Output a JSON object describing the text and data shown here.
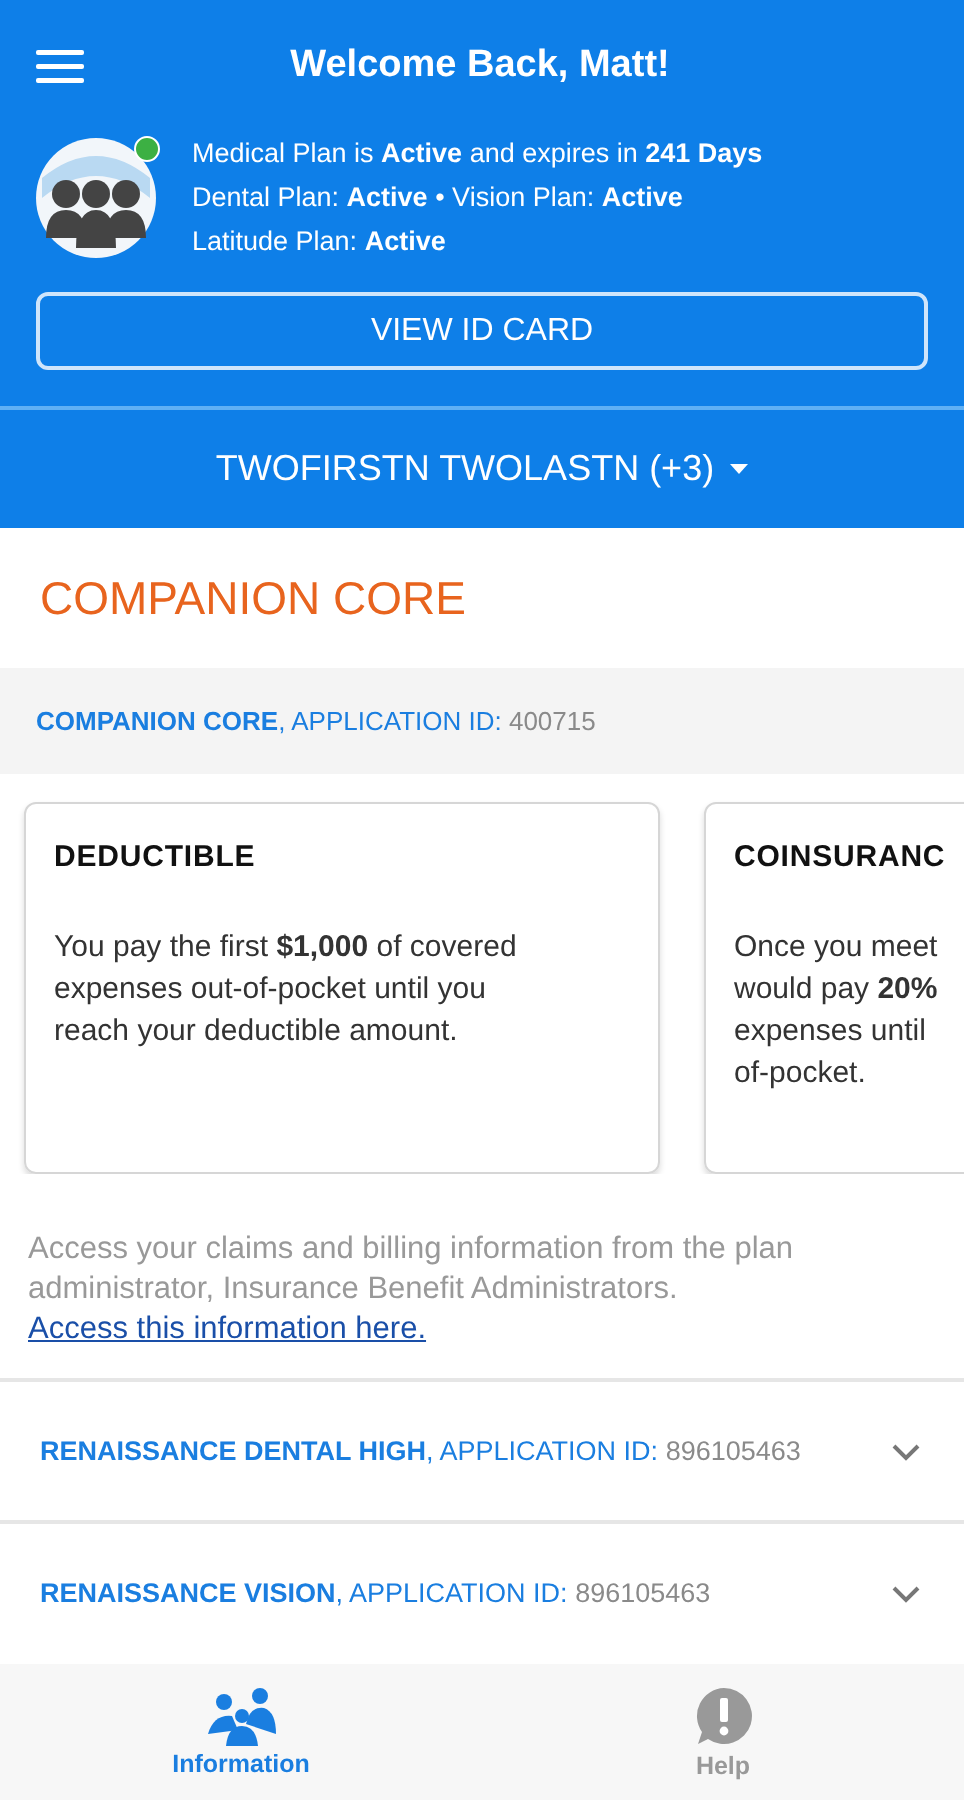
{
  "header": {
    "title": "Welcome Back, Matt!",
    "status_online": true,
    "status_lines": [
      "Medical Plan is **Active** and expires in **241 Days**",
      "Dental Plan: **Active** • Vision Plan:  **Active**",
      "Latitude Plan: **Active**"
    ],
    "id_card_button": "VIEW ID CARD"
  },
  "member_selector": {
    "label": "TWOFIRSTN TWOLASTN (+3)"
  },
  "plan": {
    "title": "COMPANION CORE",
    "name": "COMPANION CORE",
    "id_label": ", APPLICATION ID:",
    "id": "400715"
  },
  "cards": [
    {
      "title": "DEDUCTIBLE",
      "lines": [
        "You pay the first **$1,000** of covered",
        "expenses out-of-pocket until you",
        "reach your deductible amount."
      ]
    },
    {
      "title": "COINSURANC",
      "lines": [
        "Once you meet",
        "would pay **20%**",
        "expenses until",
        "of-pocket."
      ]
    }
  ],
  "notice": {
    "text": "Access your claims and billing information from the plan administrator, Insurance Benefit Administrators.",
    "link": "Access this information here."
  },
  "plans": [
    {
      "name": "RENAISSANCE DENTAL HIGH",
      "id_label": ", APPLICATION ID:",
      "id": "896105463",
      "expanded": false
    },
    {
      "name": "RENAISSANCE VISION",
      "id_label": ", APPLICATION ID:",
      "id": "896105463",
      "expanded": false
    }
  ],
  "bottom_nav": [
    {
      "kind": "people",
      "label": "Information",
      "selected": true
    },
    {
      "kind": "help",
      "label": "Help",
      "selected": false
    }
  ]
}
